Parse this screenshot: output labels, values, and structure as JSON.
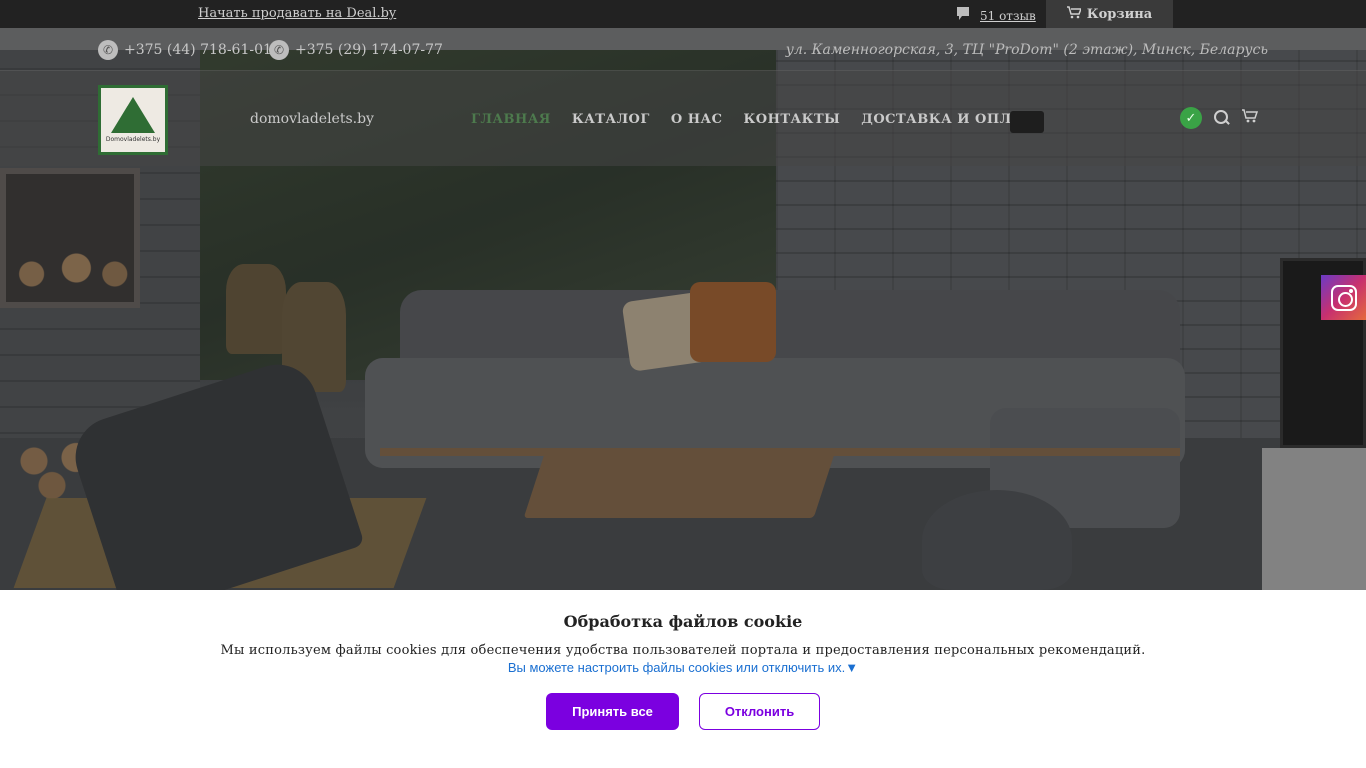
{
  "topbar": {
    "sell_link": "Начать продавать на Deal.by",
    "reviews_icon": "chat-bubble-icon",
    "reviews_label": "51 отзыв",
    "cart_icon": "cart-icon",
    "cart_label": "Корзина"
  },
  "contacts": {
    "phones": [
      "+375 (44) 718-61-01",
      "+375 (29) 174-07-77"
    ],
    "phone_icon": "phone-icon",
    "address": "ул. Каменногорская, 3, ТЦ \"ProDom\" (2 этаж), Минск, Беларусь"
  },
  "header": {
    "logo_text": "Domovladelets.by",
    "site_name": "domovladelets.by",
    "nav": [
      "ГЛАВНАЯ",
      "КАТАЛОГ",
      "О НАС",
      "КОНТАКТЫ",
      "ДОСТАВКА И ОПЛАТА"
    ],
    "active_nav": "ГЛАВНАЯ",
    "icons": [
      "check-icon",
      "search-icon",
      "cart-icon"
    ]
  },
  "social": {
    "icon": "instagram-icon"
  },
  "cookie": {
    "title": "Обработка файлов cookie",
    "text": "Мы используем файлы cookies для обеспечения удобства пользователей портала и предоставления персональных рекомендаций.",
    "settings_link": "Вы можете настроить файлы cookies или отключить их.▼",
    "accept": "Принять все",
    "decline": "Отклонить"
  },
  "colors": {
    "accent": "#7b00e0",
    "link": "#1a6fd1",
    "active_nav": "#4d7a4d",
    "topbar": "#222222"
  }
}
